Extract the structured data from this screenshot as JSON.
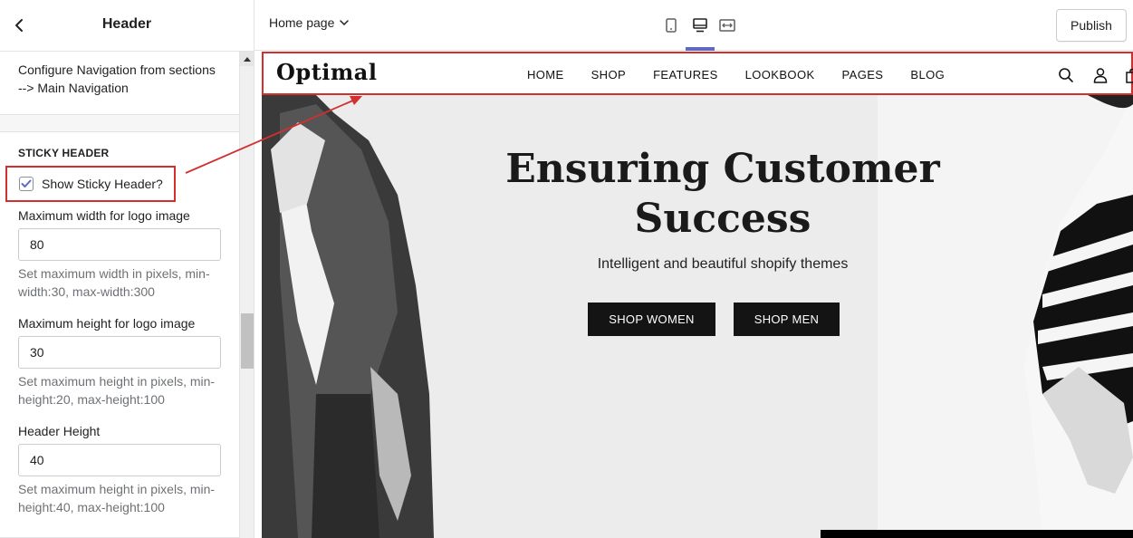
{
  "sidebar": {
    "title": "Header",
    "nav_note": "Configure Navigation from sections --> Main Navigation",
    "sticky": {
      "heading": "STICKY HEADER",
      "checkbox_label": "Show Sticky Header?",
      "checked": true,
      "fields": [
        {
          "label": "Maximum width for logo image",
          "value": "80",
          "help": "Set maximum width in pixels, min-width:30, max-width:300"
        },
        {
          "label": "Maximum height for logo image",
          "value": "30",
          "help": "Set maximum height in pixels, min-height:20, max-height:100"
        },
        {
          "label": "Header Height",
          "value": "40",
          "help": "Set maximum height in pixels, min-height:40, max-height:100"
        }
      ]
    }
  },
  "topbar": {
    "page_selector": "Home page",
    "devices": [
      "mobile-icon",
      "desktop-icon",
      "fullscreen-icon"
    ],
    "active_device": "desktop",
    "publish_label": "Publish"
  },
  "store": {
    "logo": "Optimal",
    "nav": [
      "HOME",
      "SHOP",
      "FEATURES",
      "LOOKBOOK",
      "PAGES",
      "BLOG"
    ],
    "icons": [
      "search-icon",
      "account-icon",
      "cart-icon"
    ],
    "hero": {
      "title": "Ensuring Customer Success",
      "subtitle": "Intelligent and beautiful shopify themes",
      "buttons": [
        "SHOP WOMEN",
        "SHOP MEN"
      ]
    }
  },
  "colors": {
    "highlight": "#d32f2f",
    "active_tab": "#5c6ac4",
    "button_dark": "#141414"
  }
}
